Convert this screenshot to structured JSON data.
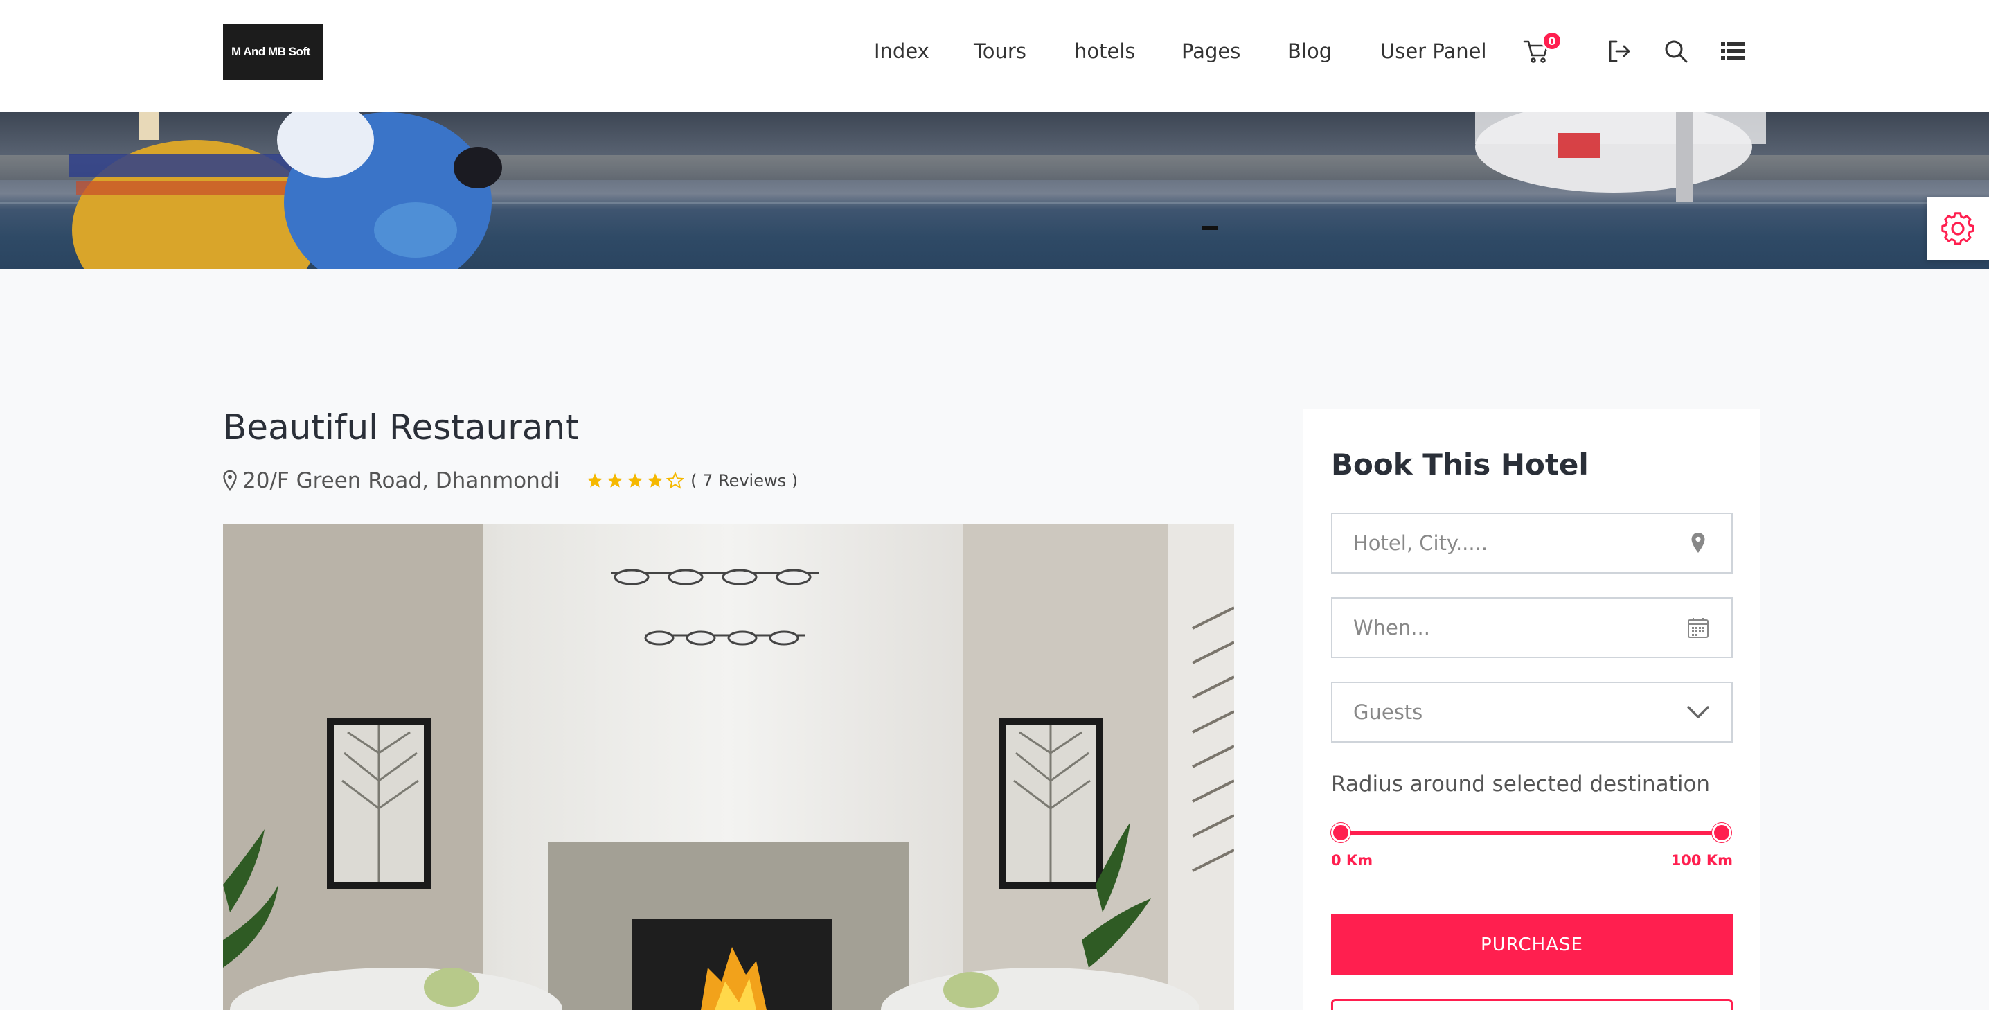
{
  "logo": {
    "text": "M And MB Soft"
  },
  "nav": {
    "items": [
      {
        "label": "Index"
      },
      {
        "label": "Tours"
      },
      {
        "label": "hotels"
      },
      {
        "label": "Pages"
      },
      {
        "label": "Blog"
      },
      {
        "label": "User Panel"
      }
    ],
    "cart_count": "0",
    "icons": [
      "cart-icon",
      "logout-icon",
      "search-icon",
      "list-menu-icon"
    ]
  },
  "hotel": {
    "name": "Beautiful Restaurant",
    "address": "20/F Green Road, Dhanmondi",
    "rating": 4,
    "rating_max": 5,
    "reviews_text": "( 7 Reviews )"
  },
  "booking": {
    "title": "Book This Hotel",
    "location_placeholder": "Hotel, City.....",
    "date_placeholder": "When...",
    "guests_value": "Guests",
    "radius_label": "Radius around selected destination",
    "radius_min_label": "0 Km",
    "radius_max_label": "100 Km",
    "radius_min": 0,
    "radius_max": 100,
    "purchase_label": "PURCHASE"
  },
  "colors": {
    "accent": "#ff1f4f",
    "star": "#f5b800",
    "text_dark": "#2a2f38"
  }
}
